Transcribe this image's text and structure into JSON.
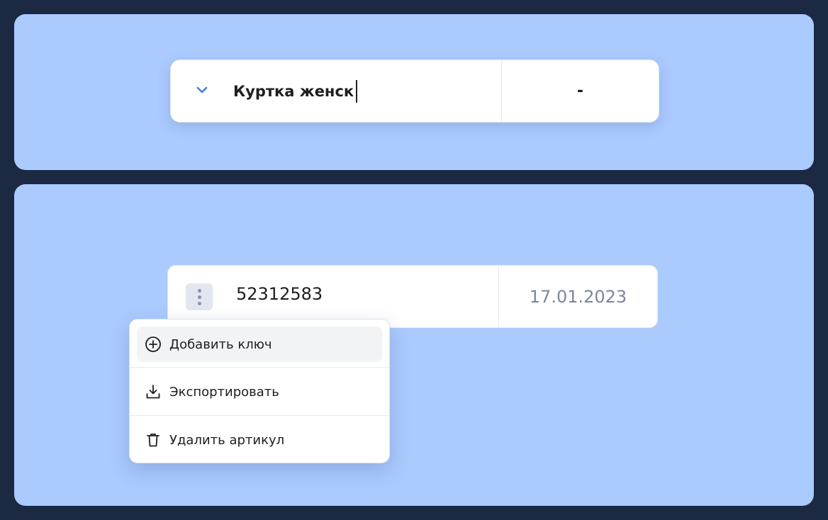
{
  "search": {
    "value": "Куртка женск",
    "secondary_value": "-"
  },
  "article": {
    "id": "52312583",
    "date": "17.01.2023"
  },
  "context_menu": {
    "items": [
      {
        "label": "Добавить ключ",
        "icon": "plus-circle-icon"
      },
      {
        "label": "Экспортировать",
        "icon": "download-icon"
      },
      {
        "label": "Удалить артикул",
        "icon": "trash-icon"
      }
    ]
  },
  "colors": {
    "frame": "#1b2943",
    "panel": "#abcafe",
    "accent": "#3e7ff0",
    "date_text": "#7c879b"
  }
}
